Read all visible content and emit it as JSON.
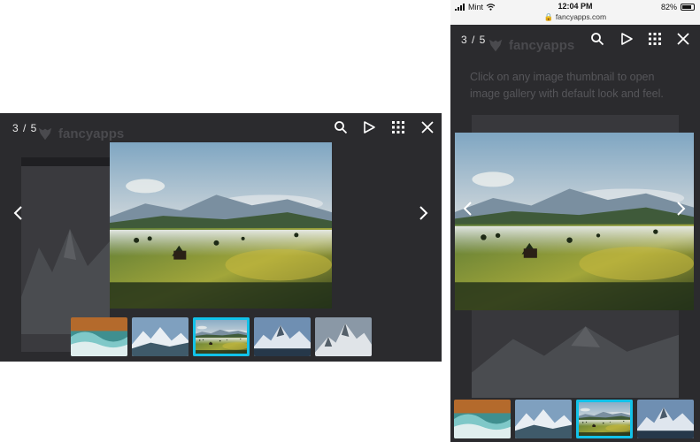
{
  "desktop": {
    "counter": "3 / 5",
    "brand": "fancyapps",
    "toolbar": {
      "search_icon": "search-icon",
      "play_icon": "play-icon",
      "grid_icon": "grid-icon",
      "close_icon": "close-icon"
    },
    "thumbnails": [
      {
        "name": "ocean-wave"
      },
      {
        "name": "snowy-mountains"
      },
      {
        "name": "misty-meadow",
        "active": true
      },
      {
        "name": "alpine-peaks"
      },
      {
        "name": "rocky-summit"
      }
    ]
  },
  "mobile": {
    "status": {
      "carrier": "Mint",
      "time": "12:04 PM",
      "url": "fancyapps.com",
      "battery": "82%",
      "battery_level": 0.82
    },
    "counter": "3 / 5",
    "brand": "fancyapps",
    "caption": "Click on any image thumbnail to open image gallery with default look and feel."
  },
  "colors": {
    "accent": "#12c2e9",
    "backdrop": "#2b2b2e",
    "icon": "#ffffff"
  }
}
